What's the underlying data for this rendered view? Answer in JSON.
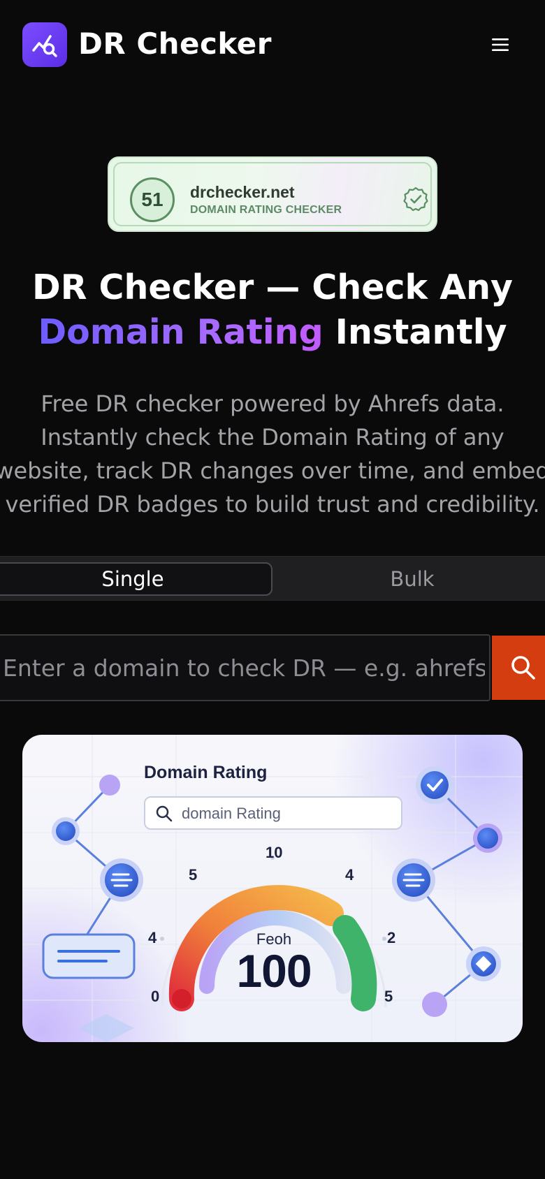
{
  "header": {
    "brand": "DR Checker",
    "logo_icon": "chart-search-icon",
    "menu_icon": "hamburger-menu-icon"
  },
  "badge": {
    "score": "51",
    "domain": "drchecker.net",
    "subtitle": "DOMAIN RATING CHECKER",
    "icon": "verified-check-icon"
  },
  "hero": {
    "title_line1": "DR Checker — Check Any",
    "title_highlight": "Domain Rating",
    "title_rest": " Instantly",
    "description": "Free DR checker powered by Ahrefs data.\nInstantly check the Domain Rating of any\nwebsite, track DR changes over time, and embed\nverified DR badges to build trust and credibility."
  },
  "tabs": {
    "single": "Single",
    "bulk": "Bulk",
    "active": "Single"
  },
  "search": {
    "placeholder": "Enter a domain to check DR — e.g. ahrefs.com",
    "value": "",
    "button_icon": "search-icon"
  },
  "illustration": {
    "title": "Domain Rating",
    "search_text": "domain Rating",
    "gauge_caption": "Feoh",
    "gauge_value": "100",
    "gauge_labels": {
      "top": "10",
      "upper_left": "5",
      "upper_right": "4",
      "mid_left": "4",
      "mid_right": "2",
      "bottom_left": "0",
      "bottom_right": "5"
    },
    "colors": {
      "red": "#e0323c",
      "orange": "#f0803a",
      "yellow": "#f5b64a",
      "green": "#3fb36a",
      "node_blue": "#3a6fe0",
      "node_purple": "#b9a3f5"
    }
  }
}
